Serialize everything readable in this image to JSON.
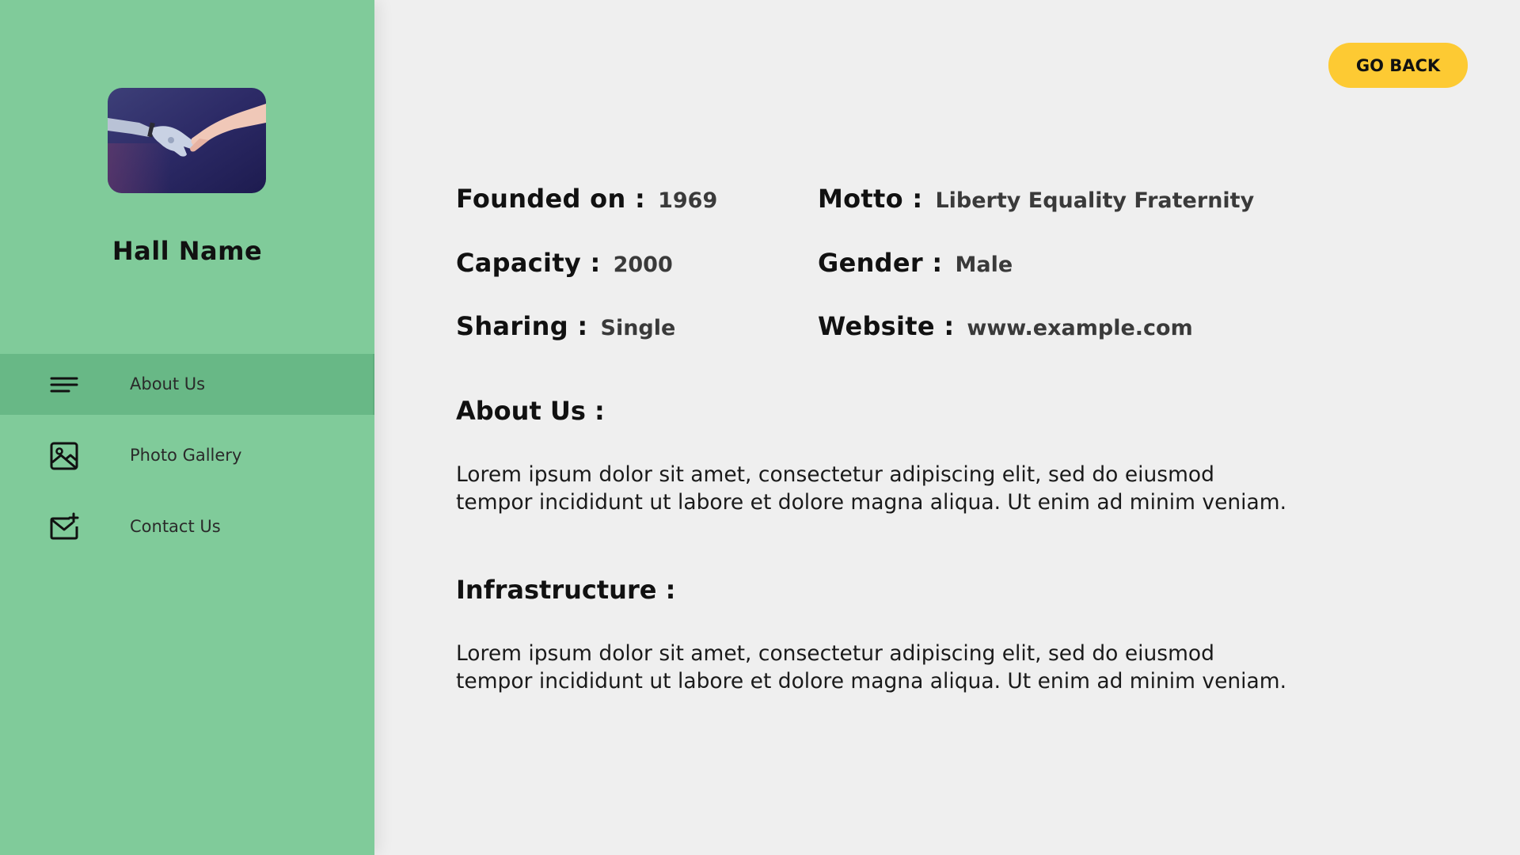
{
  "sidebar": {
    "hall_name": "Hall Name",
    "image_icon": "robot-human-handshake-image",
    "items": [
      {
        "label": "About Us",
        "icon": "menu-lines-icon",
        "active": true
      },
      {
        "label": "Photo Gallery",
        "icon": "image-icon",
        "active": false
      },
      {
        "label": "Contact Us",
        "icon": "mail-plus-icon",
        "active": false
      }
    ]
  },
  "header": {
    "go_back_label": "GO BACK"
  },
  "details": {
    "founded": {
      "label": "Founded on :",
      "value": "1969"
    },
    "capacity": {
      "label": "Capacity :",
      "value": "2000"
    },
    "sharing": {
      "label": "Sharing :",
      "value": "Single"
    },
    "motto": {
      "label": "Motto :",
      "value": "Liberty Equality Fraternity"
    },
    "gender": {
      "label": "Gender :",
      "value": "Male"
    },
    "website": {
      "label": "Website :",
      "value": "www.example.com"
    }
  },
  "about": {
    "title": "About Us :",
    "line1": "Lorem ipsum dolor sit amet, consectetur adipiscing elit, sed do eiusmod",
    "line2": "tempor incididunt ut labore et dolore magna aliqua. Ut enim ad minim veniam."
  },
  "infrastructure": {
    "title": "Infrastructure :",
    "line1": "Lorem ipsum dolor sit amet, consectetur adipiscing elit, sed do eiusmod",
    "line2": "tempor incididunt ut labore et dolore magna aliqua. Ut enim ad minim veniam."
  },
  "colors": {
    "sidebar_bg": "#80cb9a",
    "sidebar_active": "#68b886",
    "page_bg": "#efefef",
    "button_bg": "#fdca33"
  }
}
